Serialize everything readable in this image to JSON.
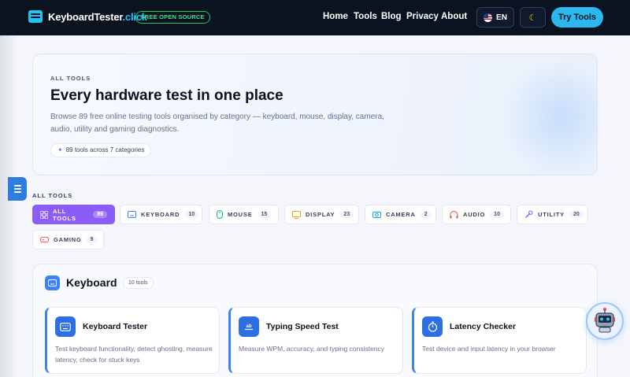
{
  "nav": {
    "logo_main": "KeyboardTester",
    "logo_accent": ".click",
    "badge": "FREE OPEN SOURCE",
    "links": [
      "Home",
      "Tools",
      "Blog",
      "Privacy",
      "About"
    ],
    "lang": "EN",
    "try_label": "Try Tools",
    "theme_icon": "moon-icon",
    "flag_icon": "us-flag-icon"
  },
  "hero": {
    "eyebrow": "ALL TOOLS",
    "title": "Every hardware test in one place",
    "description": "Browse 89 free online testing tools organised by category — keyboard, mouse, display, camera, audio, utility and gaming diagnostics.",
    "pill": "89 tools across 7 categories"
  },
  "filters": {
    "label": "ALL TOOLS",
    "chips": [
      {
        "label": "ALL TOOLS",
        "count": "89",
        "icon": "grid-icon",
        "active": true
      },
      {
        "label": "KEYBOARD",
        "count": "10",
        "icon": "keyboard-icon",
        "active": false
      },
      {
        "label": "MOUSE",
        "count": "15",
        "icon": "mouse-icon",
        "active": false
      },
      {
        "label": "DISPLAY",
        "count": "23",
        "icon": "monitor-icon",
        "active": false
      },
      {
        "label": "CAMERA",
        "count": "2",
        "icon": "camera-icon",
        "active": false
      },
      {
        "label": "AUDIO",
        "count": "10",
        "icon": "headphones-icon",
        "active": false
      },
      {
        "label": "UTILITY",
        "count": "20",
        "icon": "wrench-icon",
        "active": false
      },
      {
        "label": "GAMING",
        "count": "9",
        "icon": "gamepad-icon",
        "active": false
      }
    ]
  },
  "keyboard_section": {
    "title": "Keyboard",
    "count": "10 tools",
    "cards": [
      {
        "title": "Keyboard Tester",
        "description": "Test keyboard functionality, detect ghosting, measure latency, check for stuck keys",
        "icon": "keyboard-icon"
      },
      {
        "title": "Typing Speed Test",
        "description": "Measure WPM, accuracy, and typing consistency",
        "icon": "typing-icon"
      },
      {
        "title": "Latency Checker",
        "description": "Test device and input latency in your browser",
        "icon": "stopwatch-icon"
      }
    ]
  },
  "colors": {
    "nav_bg": "#0b1220",
    "accent_cyan": "#2ab8ef",
    "accent_purple": "#8b5cf6",
    "accent_blue": "#3b82f6"
  }
}
